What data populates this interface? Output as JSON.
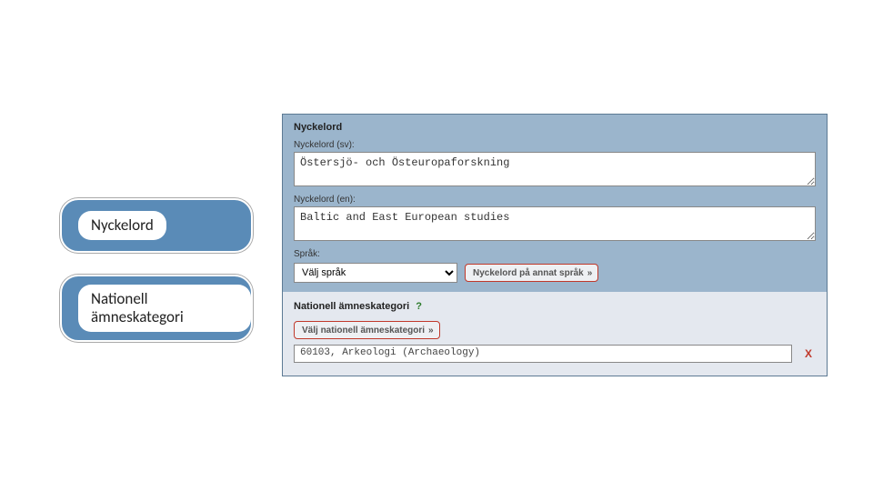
{
  "pills": {
    "keywords": "Nyckelord",
    "category": "Nationell ämneskategori"
  },
  "keywords_section": {
    "title": "Nyckelord",
    "sv_label": "Nyckelord (sv):",
    "sv_value": "Östersjö- och Östeuropaforskning",
    "en_label": "Nyckelord (en):",
    "en_value": "Baltic and East European studies",
    "lang_label": "Språk:",
    "lang_placeholder": "Välj språk",
    "other_lang_btn": "Nyckelord på annat språk"
  },
  "category_section": {
    "title": "Nationell ämneskategori",
    "help": "?",
    "choose_btn": "Välj nationell ämneskategori",
    "selected": "60103, Arkeologi (Archaeology)",
    "remove": "X"
  },
  "chevrons": "»"
}
